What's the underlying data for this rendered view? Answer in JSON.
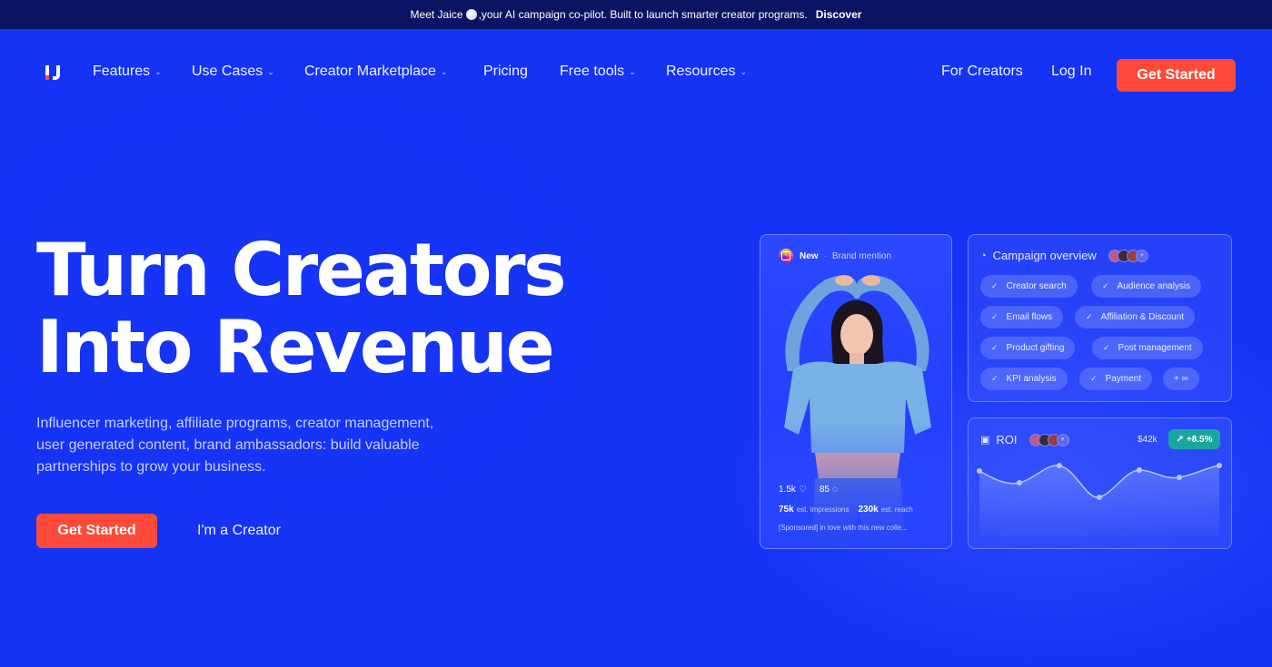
{
  "announcement": {
    "text_before": "Meet Jaice",
    "text_after": ",your AI campaign co-pilot. Built to launch smarter creator programs.",
    "link": "Discover"
  },
  "nav": {
    "items": [
      {
        "label": "Features",
        "dropdown": true
      },
      {
        "label": "Use Cases",
        "dropdown": true
      },
      {
        "label": "Creator Marketplace",
        "dropdown": true
      },
      {
        "label": "Pricing",
        "dropdown": false
      },
      {
        "label": "Free tools",
        "dropdown": true
      },
      {
        "label": "Resources",
        "dropdown": true
      }
    ],
    "for_creators": "For Creators",
    "login": "Log In",
    "cta": "Get Started"
  },
  "hero": {
    "headline_line1": "Turn Creators",
    "headline_line2": "Into Revenue",
    "subtext": "Influencer marketing, affiliate programs, creator management, user generated content, brand ambassadors: build valuable partnerships to grow your business.",
    "cta_primary": "Get Started",
    "cta_secondary": "I'm a Creator"
  },
  "post_card": {
    "badge": "New",
    "type": "Brand mention",
    "likes": "1.5k",
    "comments": "85",
    "impressions_value": "75k",
    "impressions_label": "est. impressions",
    "reach_value": "230k",
    "reach_label": "est. reach",
    "caption": "[Sponsored] in love with this new colle..."
  },
  "campaign_card": {
    "title": "Campaign overview",
    "avatars_more": "+",
    "chips": [
      "Creator search",
      "Audience analysis",
      "Email flows",
      "Affiliation & Discount",
      "Product gifting",
      "Post management",
      "KPI analysis",
      "Payment",
      "+ ∞"
    ]
  },
  "roi_card": {
    "title": "ROI",
    "value": "$42k",
    "change": "+8.5%"
  },
  "colors": {
    "background": "#1433f5",
    "announcement_bg": "#0b1463",
    "cta": "#ff4a3a",
    "roi_badge": "#18a7a0"
  }
}
